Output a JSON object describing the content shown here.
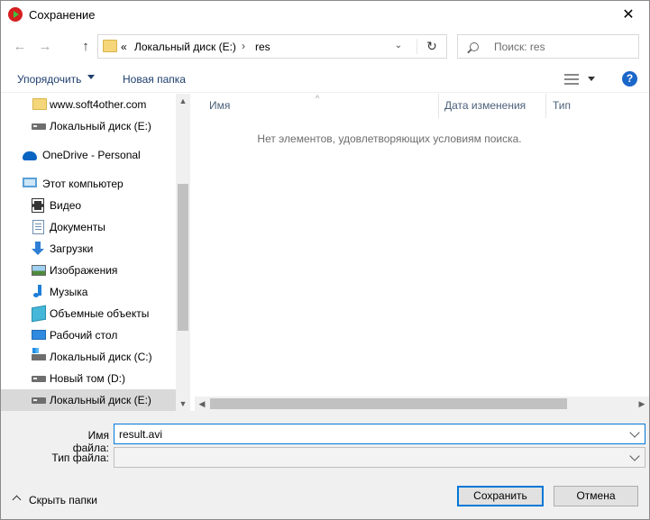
{
  "window": {
    "title": "Сохранение",
    "close_glyph": "✕"
  },
  "address": {
    "overflow": "«",
    "segments": [
      "Локальный диск (E:)",
      "res"
    ],
    "separator": "›",
    "back_glyph": "←",
    "forward_glyph": "→",
    "up_glyph": "↑",
    "dropdown_glyph": "⌄",
    "refresh_glyph": "↻"
  },
  "search": {
    "placeholder": "Поиск: res"
  },
  "toolbar": {
    "organize_label": "Упорядочить",
    "new_folder_label": "Новая папка",
    "help_label": "?"
  },
  "nav": {
    "items": [
      {
        "label": "www.soft4other.com",
        "icon": "folder-icon"
      },
      {
        "label": "Локальный диск (E:)",
        "icon": "drive-icon"
      },
      {
        "label": "OneDrive - Personal",
        "icon": "onedrive-icon"
      },
      {
        "label": "Этот компьютер",
        "icon": "computer-icon"
      },
      {
        "label": "Видео",
        "icon": "video-icon"
      },
      {
        "label": "Документы",
        "icon": "documents-icon"
      },
      {
        "label": "Загрузки",
        "icon": "downloads-icon"
      },
      {
        "label": "Изображения",
        "icon": "pictures-icon"
      },
      {
        "label": "Музыка",
        "icon": "music-icon"
      },
      {
        "label": "Объемные объекты",
        "icon": "3d-objects-icon"
      },
      {
        "label": "Рабочий стол",
        "icon": "desktop-icon"
      },
      {
        "label": "Локальный диск (C:)",
        "icon": "system-drive-icon"
      },
      {
        "label": "Новый том (D:)",
        "icon": "drive-icon"
      },
      {
        "label": "Локальный диск (E:)",
        "icon": "drive-icon",
        "selected": true
      }
    ],
    "scroll_up_glyph": "▲",
    "scroll_down_glyph": "▼"
  },
  "content": {
    "columns": [
      "Имя",
      "Дата изменения",
      "Тип"
    ],
    "sort_glyph": "^",
    "empty_message": "Нет элементов, удовлетворяющих условиям поиска.",
    "scroll_left_glyph": "◀",
    "scroll_right_glyph": "▶"
  },
  "form": {
    "filename_label": "Имя файла:",
    "filename_value": "result.avi",
    "filetype_label": "Тип файла:",
    "filetype_value": ""
  },
  "footer": {
    "hide_folders_label": "Скрыть папки",
    "save_label": "Сохранить",
    "cancel_label": "Отмена"
  },
  "colors": {
    "accent": "#0078d7",
    "selection": "#d9d9d9",
    "link_text": "#1e3f6e",
    "help": "#1b66c9"
  }
}
